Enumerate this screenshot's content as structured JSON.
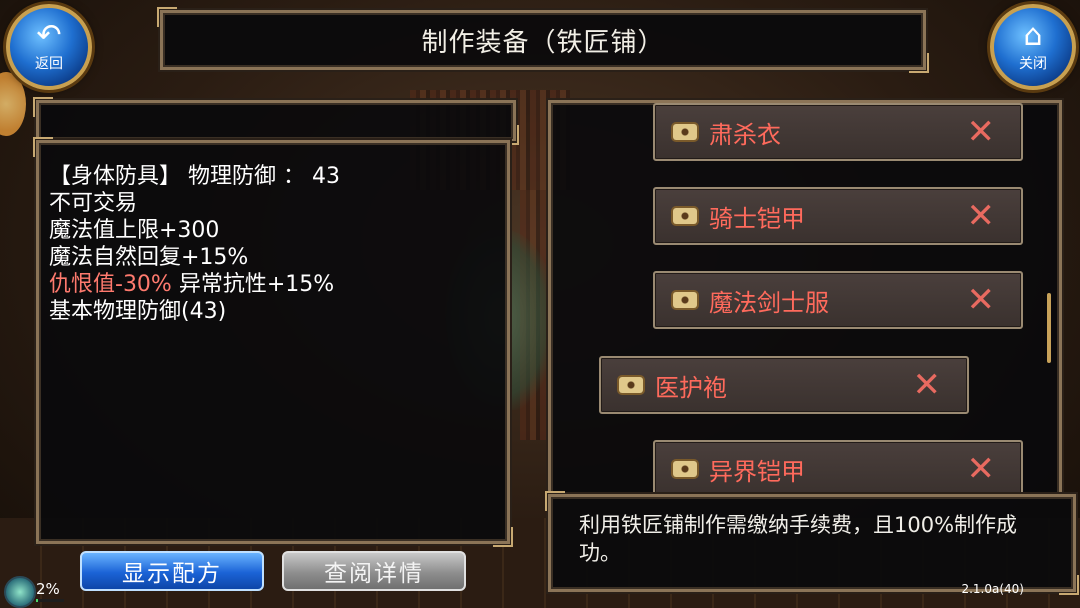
{
  "title": "制作装备（铁匠铺）",
  "back_button": {
    "icon": "back-arrow-icon",
    "label": "返回"
  },
  "close_button": {
    "icon": "home-icon",
    "label": "关闭"
  },
  "stats": {
    "line1": "【身体防具】 物理防御 ：  43",
    "line2": "不可交易",
    "line3": "魔法值上限+300",
    "line4": "魔法自然回复+15%",
    "line5_red": "仇恨值-30%",
    "line5_rest": " 异常抗性+15%",
    "line6": "基本物理防御(43)"
  },
  "recipes": [
    {
      "name": "肃杀衣"
    },
    {
      "name": "骑士铠甲"
    },
    {
      "name": "魔法剑士服"
    },
    {
      "name": "医护袍"
    },
    {
      "name": "异界铠甲"
    }
  ],
  "message": "利用铁匠铺制作需缴纳手续费，且100%制作成功。",
  "buttons": {
    "show_recipe": "显示配方",
    "view_details": "查阅详情"
  },
  "status": {
    "percent_label": "2%",
    "progress": 0.02,
    "version": "2.1.0a(40)"
  },
  "colors": {
    "accent_red": "#ff6a5c",
    "frame": "#8b7457",
    "blue_button": "#1b63d6"
  }
}
